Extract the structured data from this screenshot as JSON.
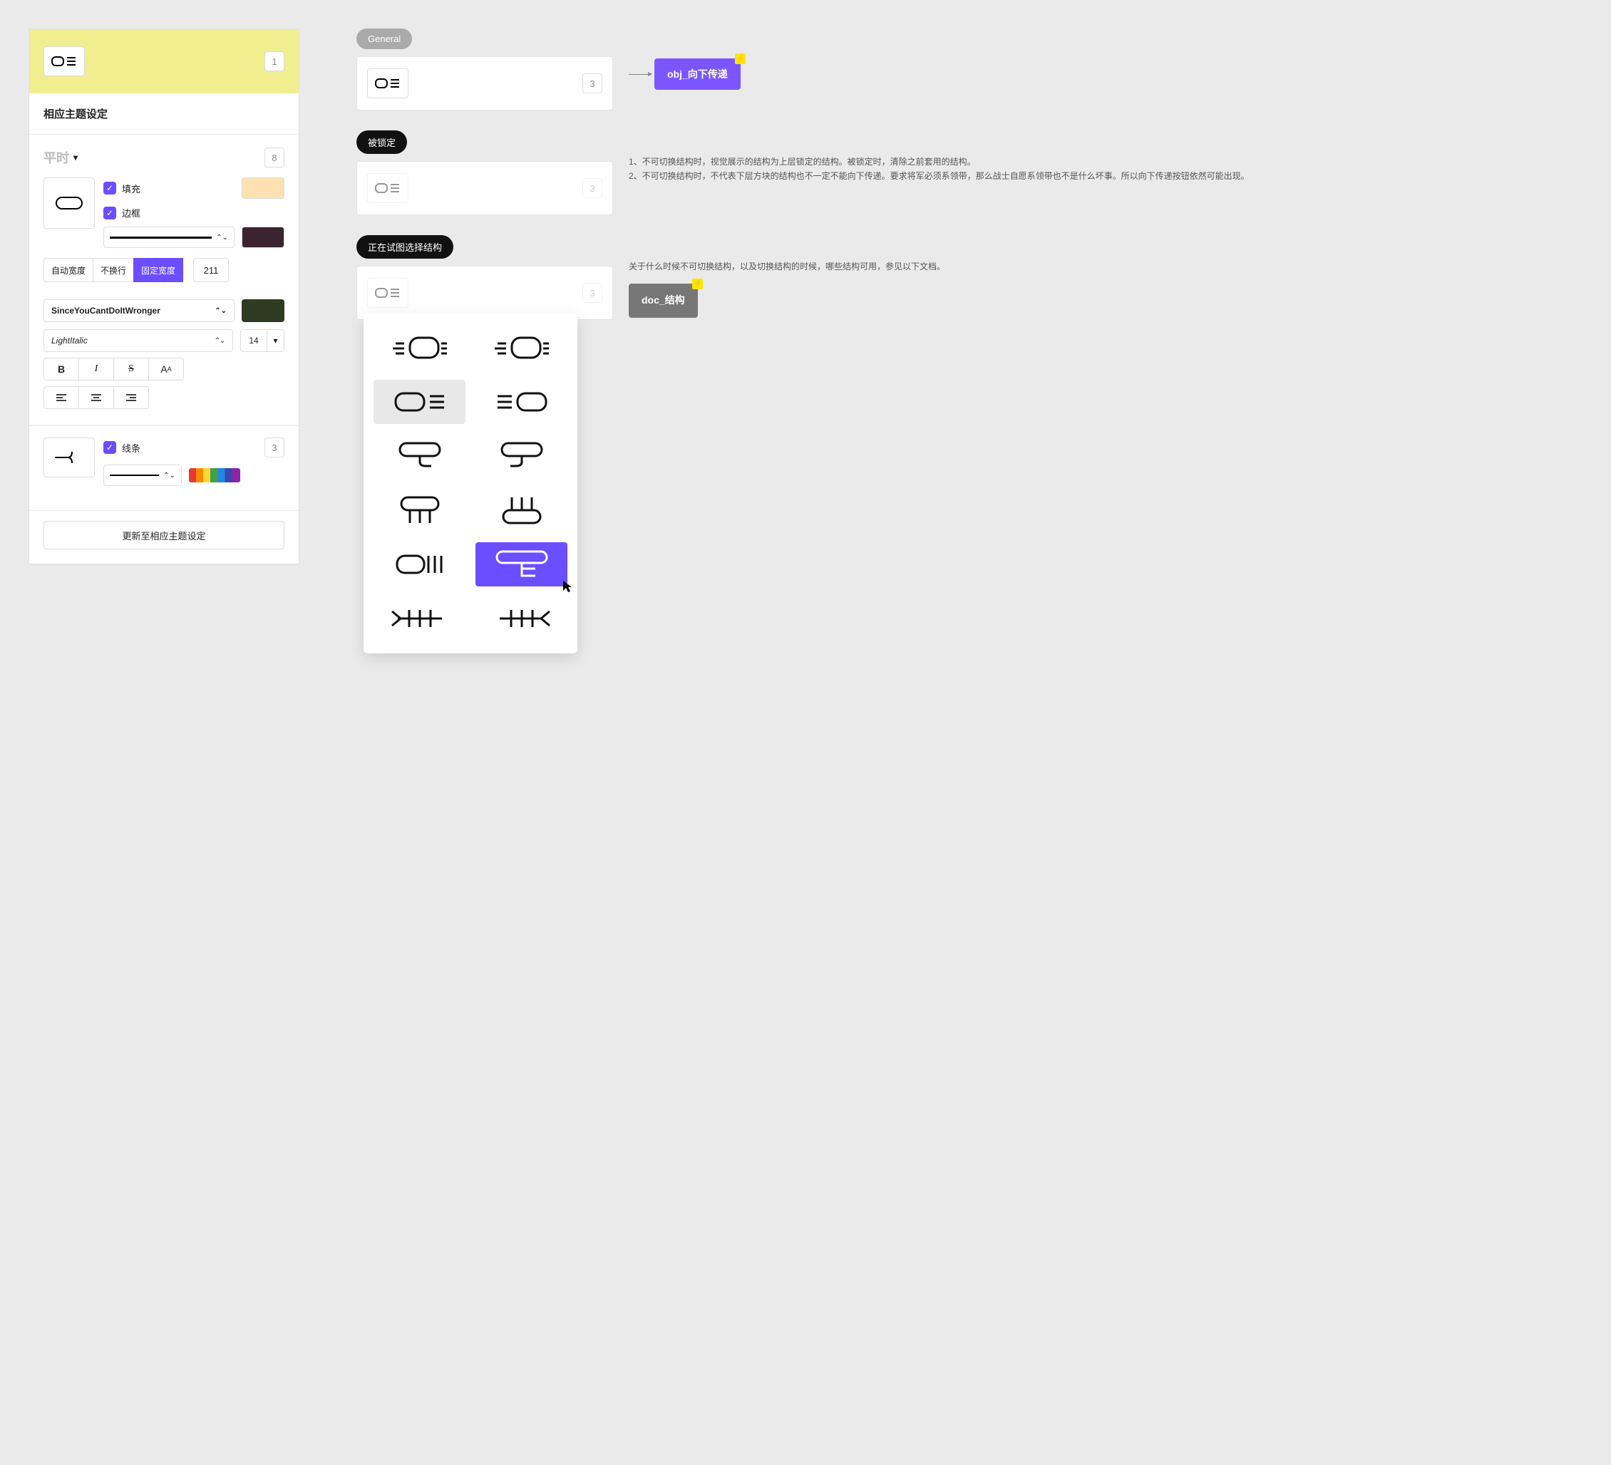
{
  "left": {
    "top_badge": "1",
    "section_title": "相应主题设定",
    "state_label": "平时",
    "state_badge": "8",
    "fill_label": "填充",
    "border_label": "边框",
    "fill_color": "#fde1b0",
    "border_color": "#3a2430",
    "width_auto": "自动宽度",
    "width_nowrap": "不换行",
    "width_fixed": "固定宽度",
    "width_value": "211",
    "font_family": "SinceYouCantDoItWronger",
    "font_color": "#2f3a22",
    "font_style": "LightItalic",
    "font_size": "14",
    "line_label": "线条",
    "line_badge": "3",
    "update_btn": "更新至相应主题设定"
  },
  "right": {
    "general_label": "General",
    "general_badge": "3",
    "general_tag": "obj_向下传递",
    "locked_label": "被锁定",
    "locked_badge": "3",
    "locked_note": "1、不可切换结构时，视觉展示的结构为上层锁定的结构。被锁定时，清除之前套用的结构。\n2、不可切换结构时，不代表下层方块的结构也不一定不能向下传递。要求将军必须系领带，那么战士自愿系领带也不是什么坏事。所以向下传递按钮依然可能出现。",
    "selecting_label": "正在试图选择结构",
    "selecting_badge": "3",
    "selecting_note": "关于什么时候不可切换结构，以及切换结构的时候，哪些结构可用，参见以下文档。",
    "doc_tag": "doc_结构"
  }
}
